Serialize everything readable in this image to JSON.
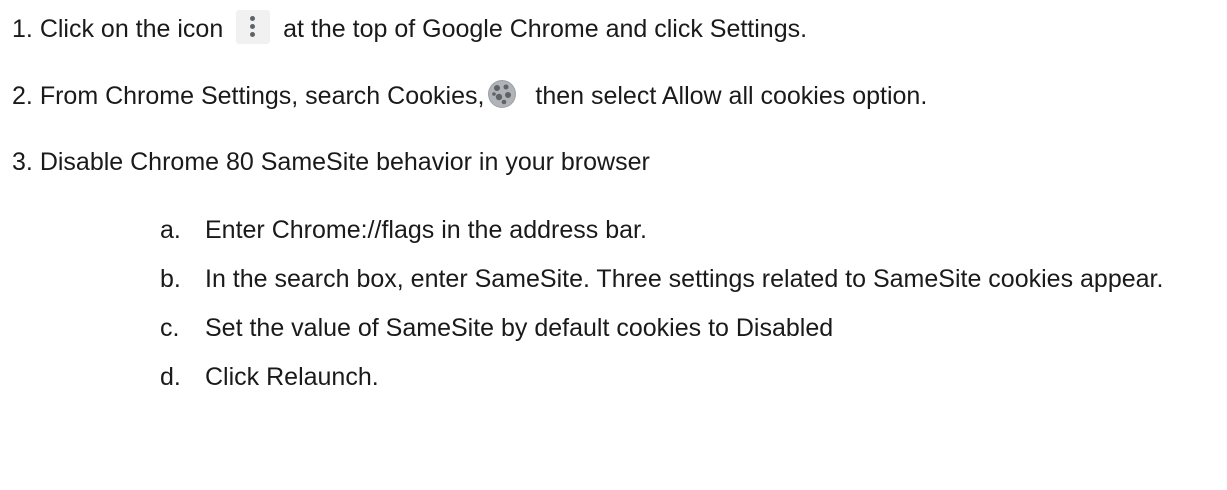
{
  "steps": [
    {
      "number": "1.",
      "text_before_icon": "Click on the icon",
      "icon": "three-dot-menu-icon",
      "text_after_icon": "at the top of Google Chrome and click Settings."
    },
    {
      "number": "2.",
      "text_before_icon": "From Chrome Settings, search Cookies,",
      "icon": "cookie-icon",
      "text_after_icon": "then select Allow all cookies option."
    },
    {
      "number": "3.",
      "text": "Disable Chrome 80 SameSite behavior in your browser"
    }
  ],
  "substeps": [
    {
      "marker": "a.",
      "text": "Enter Chrome://flags in the address bar."
    },
    {
      "marker": "b.",
      "text": "In the search box, enter SameSite. Three settings related to SameSite cookies appear."
    },
    {
      "marker": "c.",
      "text": "Set the value of SameSite by default cookies to Disabled"
    },
    {
      "marker": "d.",
      "text": "Click Relaunch."
    }
  ],
  "colors": {
    "text": "#1a1a1a",
    "icon_gray": "#5f6368"
  }
}
